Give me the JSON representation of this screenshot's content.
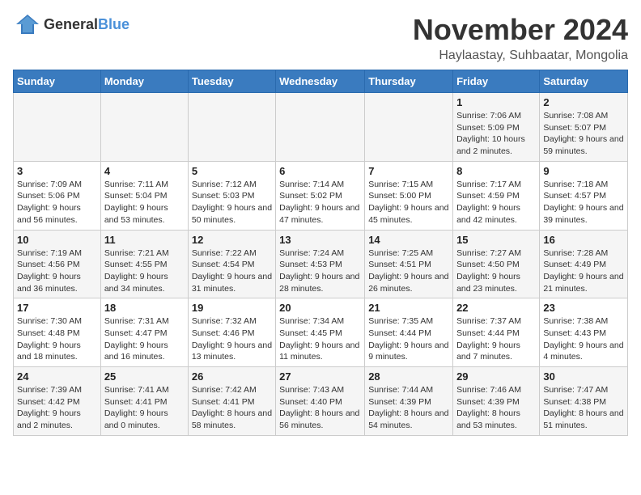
{
  "logo": {
    "general": "General",
    "blue": "Blue"
  },
  "title": "November 2024",
  "location": "Haylaastay, Suhbaatar, Mongolia",
  "weekdays": [
    "Sunday",
    "Monday",
    "Tuesday",
    "Wednesday",
    "Thursday",
    "Friday",
    "Saturday"
  ],
  "weeks": [
    [
      {
        "day": "",
        "detail": ""
      },
      {
        "day": "",
        "detail": ""
      },
      {
        "day": "",
        "detail": ""
      },
      {
        "day": "",
        "detail": ""
      },
      {
        "day": "",
        "detail": ""
      },
      {
        "day": "1",
        "detail": "Sunrise: 7:06 AM\nSunset: 5:09 PM\nDaylight: 10 hours and 2 minutes."
      },
      {
        "day": "2",
        "detail": "Sunrise: 7:08 AM\nSunset: 5:07 PM\nDaylight: 9 hours and 59 minutes."
      }
    ],
    [
      {
        "day": "3",
        "detail": "Sunrise: 7:09 AM\nSunset: 5:06 PM\nDaylight: 9 hours and 56 minutes."
      },
      {
        "day": "4",
        "detail": "Sunrise: 7:11 AM\nSunset: 5:04 PM\nDaylight: 9 hours and 53 minutes."
      },
      {
        "day": "5",
        "detail": "Sunrise: 7:12 AM\nSunset: 5:03 PM\nDaylight: 9 hours and 50 minutes."
      },
      {
        "day": "6",
        "detail": "Sunrise: 7:14 AM\nSunset: 5:02 PM\nDaylight: 9 hours and 47 minutes."
      },
      {
        "day": "7",
        "detail": "Sunrise: 7:15 AM\nSunset: 5:00 PM\nDaylight: 9 hours and 45 minutes."
      },
      {
        "day": "8",
        "detail": "Sunrise: 7:17 AM\nSunset: 4:59 PM\nDaylight: 9 hours and 42 minutes."
      },
      {
        "day": "9",
        "detail": "Sunrise: 7:18 AM\nSunset: 4:57 PM\nDaylight: 9 hours and 39 minutes."
      }
    ],
    [
      {
        "day": "10",
        "detail": "Sunrise: 7:19 AM\nSunset: 4:56 PM\nDaylight: 9 hours and 36 minutes."
      },
      {
        "day": "11",
        "detail": "Sunrise: 7:21 AM\nSunset: 4:55 PM\nDaylight: 9 hours and 34 minutes."
      },
      {
        "day": "12",
        "detail": "Sunrise: 7:22 AM\nSunset: 4:54 PM\nDaylight: 9 hours and 31 minutes."
      },
      {
        "day": "13",
        "detail": "Sunrise: 7:24 AM\nSunset: 4:53 PM\nDaylight: 9 hours and 28 minutes."
      },
      {
        "day": "14",
        "detail": "Sunrise: 7:25 AM\nSunset: 4:51 PM\nDaylight: 9 hours and 26 minutes."
      },
      {
        "day": "15",
        "detail": "Sunrise: 7:27 AM\nSunset: 4:50 PM\nDaylight: 9 hours and 23 minutes."
      },
      {
        "day": "16",
        "detail": "Sunrise: 7:28 AM\nSunset: 4:49 PM\nDaylight: 9 hours and 21 minutes."
      }
    ],
    [
      {
        "day": "17",
        "detail": "Sunrise: 7:30 AM\nSunset: 4:48 PM\nDaylight: 9 hours and 18 minutes."
      },
      {
        "day": "18",
        "detail": "Sunrise: 7:31 AM\nSunset: 4:47 PM\nDaylight: 9 hours and 16 minutes."
      },
      {
        "day": "19",
        "detail": "Sunrise: 7:32 AM\nSunset: 4:46 PM\nDaylight: 9 hours and 13 minutes."
      },
      {
        "day": "20",
        "detail": "Sunrise: 7:34 AM\nSunset: 4:45 PM\nDaylight: 9 hours and 11 minutes."
      },
      {
        "day": "21",
        "detail": "Sunrise: 7:35 AM\nSunset: 4:44 PM\nDaylight: 9 hours and 9 minutes."
      },
      {
        "day": "22",
        "detail": "Sunrise: 7:37 AM\nSunset: 4:44 PM\nDaylight: 9 hours and 7 minutes."
      },
      {
        "day": "23",
        "detail": "Sunrise: 7:38 AM\nSunset: 4:43 PM\nDaylight: 9 hours and 4 minutes."
      }
    ],
    [
      {
        "day": "24",
        "detail": "Sunrise: 7:39 AM\nSunset: 4:42 PM\nDaylight: 9 hours and 2 minutes."
      },
      {
        "day": "25",
        "detail": "Sunrise: 7:41 AM\nSunset: 4:41 PM\nDaylight: 9 hours and 0 minutes."
      },
      {
        "day": "26",
        "detail": "Sunrise: 7:42 AM\nSunset: 4:41 PM\nDaylight: 8 hours and 58 minutes."
      },
      {
        "day": "27",
        "detail": "Sunrise: 7:43 AM\nSunset: 4:40 PM\nDaylight: 8 hours and 56 minutes."
      },
      {
        "day": "28",
        "detail": "Sunrise: 7:44 AM\nSunset: 4:39 PM\nDaylight: 8 hours and 54 minutes."
      },
      {
        "day": "29",
        "detail": "Sunrise: 7:46 AM\nSunset: 4:39 PM\nDaylight: 8 hours and 53 minutes."
      },
      {
        "day": "30",
        "detail": "Sunrise: 7:47 AM\nSunset: 4:38 PM\nDaylight: 8 hours and 51 minutes."
      }
    ]
  ]
}
